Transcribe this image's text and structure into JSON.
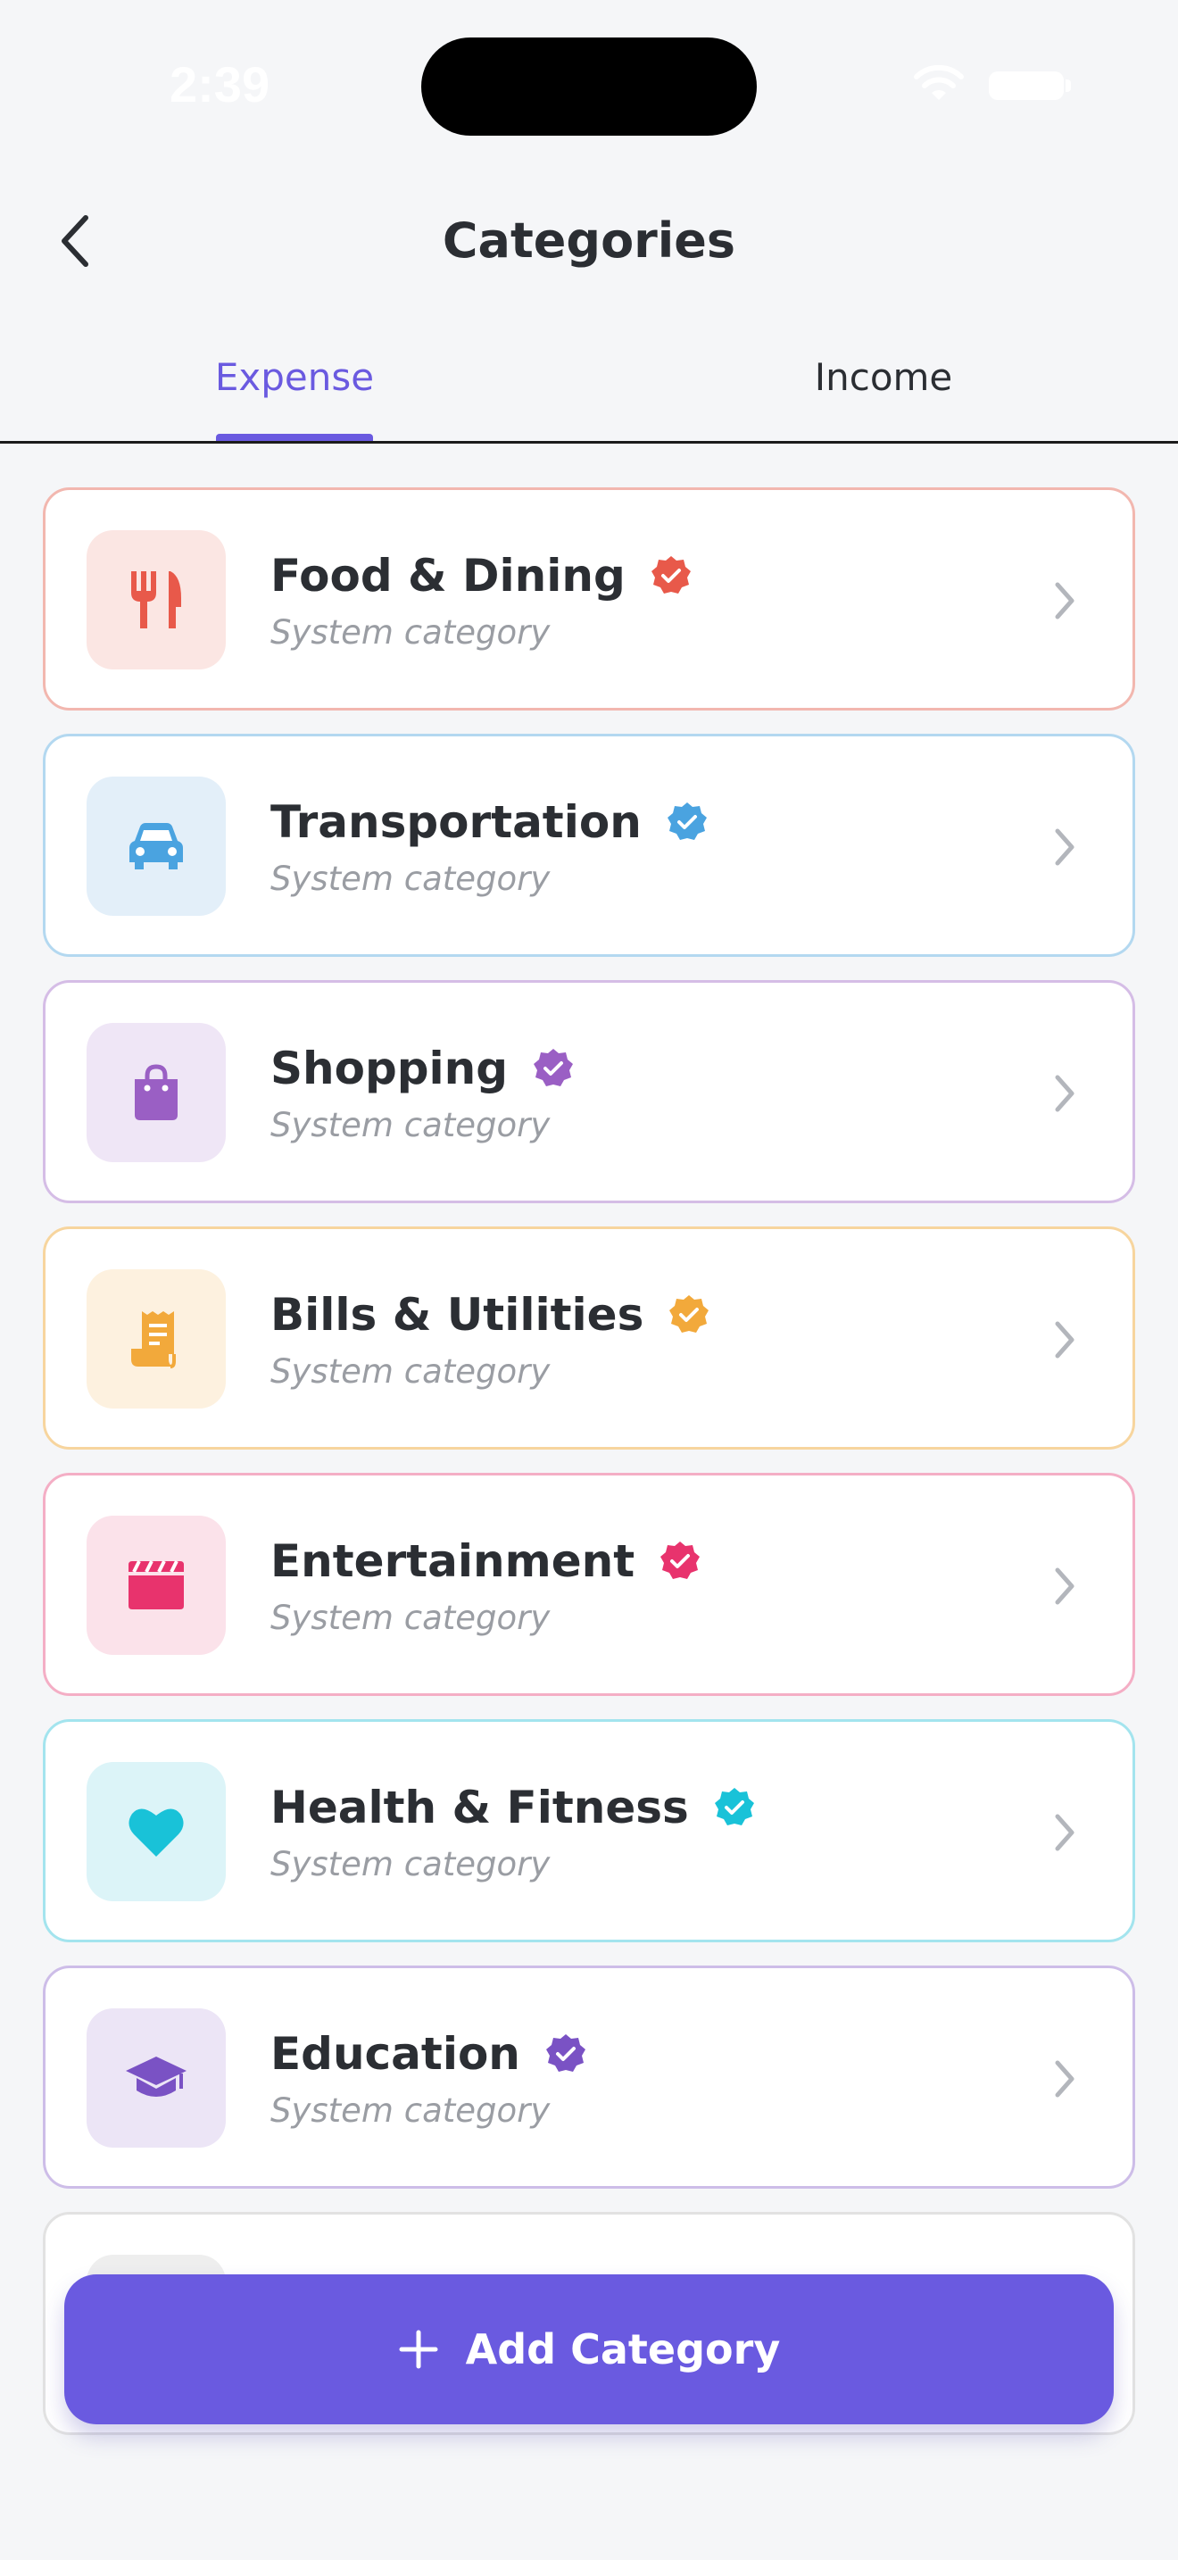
{
  "status_bar": {
    "time": "2:39"
  },
  "header": {
    "title": "Categories",
    "back_icon": "chevron-left-icon"
  },
  "tabs": [
    {
      "label": "Expense",
      "selected": true
    },
    {
      "label": "Income",
      "selected": false
    }
  ],
  "categories": [
    {
      "name": "Food & Dining",
      "subtitle": "System category",
      "icon": "fork-knife-icon",
      "color": "#e8594a",
      "tint": "#fbe6e3",
      "border": "#f2b7af"
    },
    {
      "name": "Transportation",
      "subtitle": "System category",
      "icon": "car-icon",
      "color": "#4aa3e0",
      "tint": "#e3eff9",
      "border": "#b3d8f0"
    },
    {
      "name": "Shopping",
      "subtitle": "System category",
      "icon": "shopping-bag-icon",
      "color": "#9a5fc4",
      "tint": "#efe6f6",
      "border": "#d5bde6"
    },
    {
      "name": "Bills & Utilities",
      "subtitle": "System category",
      "icon": "receipt-icon",
      "color": "#f2a93b",
      "tint": "#fdf1df",
      "border": "#f7d59e"
    },
    {
      "name": "Entertainment",
      "subtitle": "System category",
      "icon": "clapperboard-icon",
      "color": "#e8336d",
      "tint": "#fbe2ea",
      "border": "#f4aec5"
    },
    {
      "name": "Health & Fitness",
      "subtitle": "System category",
      "icon": "heart-icon",
      "color": "#19c2d8",
      "tint": "#dcf4f8",
      "border": "#a3e4ee"
    },
    {
      "name": "Education",
      "subtitle": "System category",
      "icon": "graduation-cap-icon",
      "color": "#7a52c4",
      "tint": "#ece5f6",
      "border": "#cdbde8"
    },
    {
      "name": "",
      "subtitle": "",
      "icon": "",
      "color": "#9a9da3",
      "tint": "#eeeeee",
      "border": "#e2e2e2"
    }
  ],
  "add_button": {
    "label": "Add Category",
    "icon": "plus-icon"
  },
  "colors": {
    "accent": "#6a5ae0",
    "background": "#f5f6f8"
  }
}
